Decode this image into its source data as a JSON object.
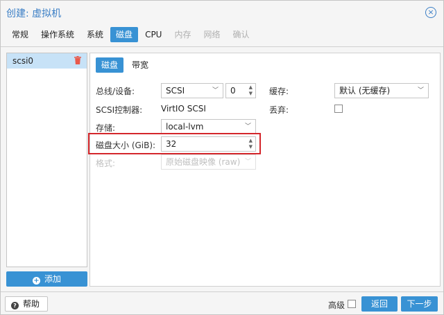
{
  "window": {
    "title": "创建: 虚拟机",
    "close_glyph": "⊗"
  },
  "tabs": [
    {
      "label": "常规",
      "state": "normal"
    },
    {
      "label": "操作系统",
      "state": "normal"
    },
    {
      "label": "系统",
      "state": "normal"
    },
    {
      "label": "磁盘",
      "state": "active"
    },
    {
      "label": "CPU",
      "state": "normal"
    },
    {
      "label": "内存",
      "state": "disabled"
    },
    {
      "label": "网络",
      "state": "disabled"
    },
    {
      "label": "确认",
      "state": "disabled"
    }
  ],
  "disk_list": {
    "items": [
      {
        "label": "scsi0"
      }
    ],
    "add_label": "添加"
  },
  "subtabs": [
    {
      "label": "磁盘"
    },
    {
      "label": "带宽"
    }
  ],
  "form": {
    "bus_label": "总线/设备:",
    "bus_value": "SCSI",
    "device_index": "0",
    "controller_label": "SCSI控制器:",
    "controller_value": "VirtIO SCSI",
    "storage_label": "存储:",
    "storage_value": "local-lvm",
    "size_label": "磁盘大小 (GiB):",
    "size_value": "32",
    "format_label": "格式:",
    "format_value": "原始磁盘映像 (raw)",
    "cache_label": "缓存:",
    "cache_value": "默认 (无缓存)",
    "discard_label": "丢弃:"
  },
  "footer": {
    "help_label": "帮助",
    "advanced_label": "高级",
    "back_label": "返回",
    "next_label": "下一步"
  },
  "colors": {
    "accent": "#3892d4",
    "highlight_border": "#d4262b",
    "selected_row": "#c7e2f7"
  }
}
